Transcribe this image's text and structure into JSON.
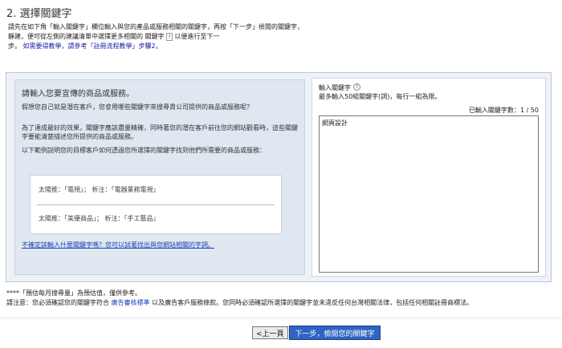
{
  "step_title": "2. 選擇關鍵字",
  "intro": {
    "line1": "請先在如下角「輸入關鍵字」欄位輸入與您的產品或服務相關的關鍵字，再按「下一步」檢閱的關鍵字，",
    "line2a": "靜建，便可從左側的建議清單中選擇更多相關的",
    "line2b": "關鍵字",
    "hint_icon": "?",
    "line2c": "以便進行至下一",
    "line3a": "步。",
    "line3_link": "如需要得教學，請參考「註冊流程教學」步驟2。"
  },
  "left_panel": {
    "heading": "請輸入您要宣傳的商品或服務。",
    "para1": "假想您自己就是潛在客戶，您會用哪些關鍵字來搜尋貴公司提供的商品或服務呢？",
    "para2": "為了達成最好的效果，關鍵字應該盡量精確，同時著您的潛在客戶前往您的網站觀看時，這些關鍵字要能清楚描述您所提供的商品或服務。",
    "para3": "以下範例說明您的目標客戶如何透過您所選擇的關鍵字找到他們所需要的商品或服務：",
    "example1": "太陽推：「電視」；  析注：「電器業務電視」",
    "example2": "太陽推：「美優商品」；  析注：「手工藝品」",
    "help_link": "不確定該輸入什麼關鍵字嗎？您可以試著找出與您網站相關的字詞。"
  },
  "right_panel": {
    "label": "輸入關鍵字",
    "help_icon": "?",
    "sub": "最多輸入50組關鍵字(詞)，每行一組為限。",
    "count_label": "已輸入關鍵字數：",
    "count_value": "1 / 50",
    "keywords_value": "網頁設計"
  },
  "footnote": "****「預估每月搜尋量」為預估值，僅供參考。",
  "notice": {
    "prefix": "請注意：您必須確認您的關鍵字符合",
    "link": "廣告審核標準",
    "suffix": "以及廣告客戶服務條款。您同時必須確認所選擇的關鍵字並未違反任何台灣相關法律，包括任何相關註冊商標法。"
  },
  "buttons": {
    "prev": "<上一頁",
    "next": "下一步，檢閱您的關鍵字"
  }
}
